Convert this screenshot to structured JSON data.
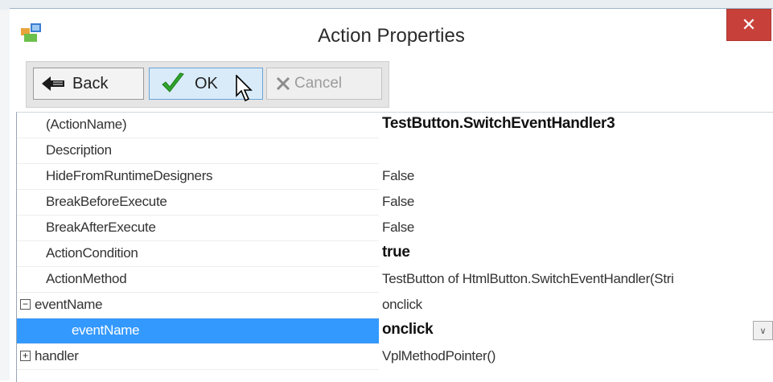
{
  "window": {
    "title": "Action Properties",
    "close_glyph": "✕",
    "accent": "#c7413a"
  },
  "toolbar": {
    "back_label": "Back",
    "ok_label": "OK",
    "cancel_label": "Cancel"
  },
  "grid": {
    "selection_color": "#3399ff",
    "rows": [
      {
        "name": "(ActionName)",
        "value": "TestButton.SwitchEventHandler3",
        "bold": true
      },
      {
        "name": "Description",
        "value": ""
      },
      {
        "name": "HideFromRuntimeDesigners",
        "value": "False"
      },
      {
        "name": "BreakBeforeExecute",
        "value": "False"
      },
      {
        "name": "BreakAfterExecute",
        "value": "False"
      },
      {
        "name": "ActionCondition",
        "value": "true",
        "bold": true
      },
      {
        "name": "ActionMethod",
        "value": "TestButton of HtmlButton.SwitchEventHandler(Stri"
      },
      {
        "name": "eventName",
        "value": "onclick",
        "expander": "⊟"
      },
      {
        "name": "eventName",
        "value": "onclick",
        "bold": true,
        "selected": true
      },
      {
        "name": "handler",
        "value": "VplMethodPointer()",
        "expander": "⊞"
      }
    ]
  }
}
